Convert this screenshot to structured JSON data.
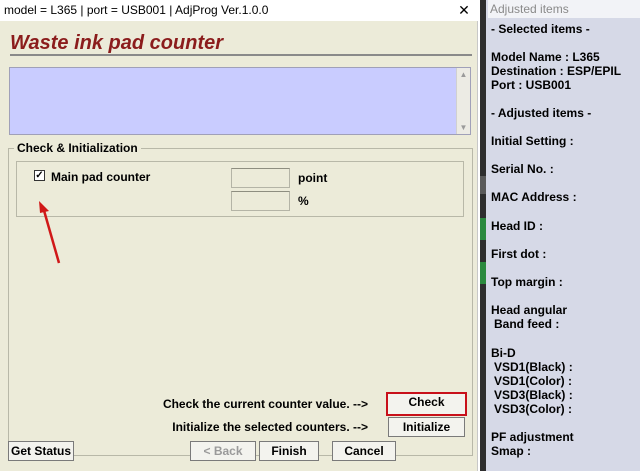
{
  "window": {
    "title": "model = L365 | port = USB001 | AdjProg Ver.1.0.0",
    "close_glyph": "✕"
  },
  "heading": "Waste ink pad counter",
  "group": {
    "legend": "Check & Initialization",
    "checkbox_checked": true,
    "checkbox_glyph": "✓",
    "checkbox_label": "Main pad counter",
    "unit_point": "point",
    "unit_percent": "%"
  },
  "actions": {
    "check_text": "Check the current counter value. -->",
    "check_button": "Check",
    "init_text": "Initialize the selected counters. -->",
    "init_button": "Initialize"
  },
  "footer": {
    "get_status": "Get Status",
    "back": "< Back",
    "finish": "Finish",
    "cancel": "Cancel"
  },
  "side": {
    "header": "Adjusted items",
    "selected_title": "- Selected items -",
    "model_name": "Model Name : L365",
    "destination": "Destination : ESP/EPIL",
    "port": "Port : USB001",
    "adjusted_title": "- Adjusted items -",
    "initial_setting": "Initial Setting :",
    "serial_no": "Serial No. :",
    "mac_address": "MAC Address :",
    "head_id": "Head ID :",
    "first_dot": "First dot :",
    "top_margin": "Top margin :",
    "head_angular": "Head angular",
    "band_feed": "Band feed :",
    "bid": "Bi-D",
    "vsd1_black": "VSD1(Black) :",
    "vsd1_color": "VSD1(Color) :",
    "vsd3_black": "VSD3(Black) :",
    "vsd3_color": "VSD3(Color) :",
    "pf_adjustment": "PF adjustment",
    "smap": "Smap :"
  },
  "colors": {
    "heading": "#8b1c1c",
    "info_box": "#c9ccff",
    "highlight": "#c8101a",
    "panel_bg": "#ecebd9"
  }
}
